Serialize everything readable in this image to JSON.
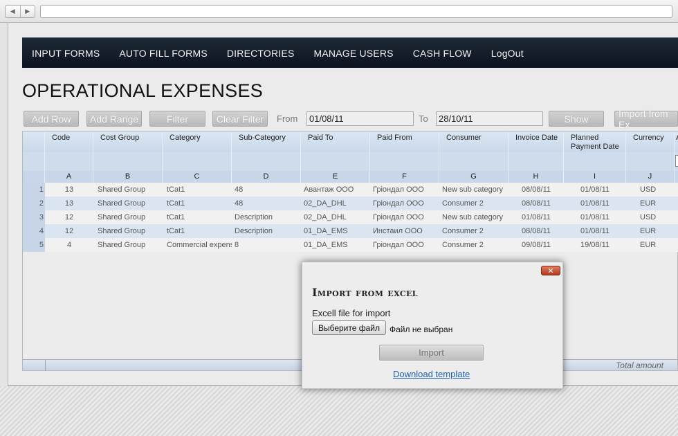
{
  "nav": {
    "items": [
      "INPUT FORMS",
      "AUTO FILL FORMS",
      "DIRECTORIES",
      "MANAGE USERS",
      "CASH FLOW",
      "LogOut"
    ]
  },
  "page": {
    "title": "OPERATIONAL EXPENSES"
  },
  "toolbar": {
    "add_row": "Add Row",
    "add_range": "Add Range",
    "filter": "Filter",
    "clear_filter": "Clear Filter",
    "from_label": "From",
    "from_value": "01/08/11",
    "to_label": "To",
    "to_value": "28/10/11",
    "show": "Show",
    "import": "Import from Ex"
  },
  "grid": {
    "headers": [
      "Code",
      "Cost Group",
      "Category",
      "Sub-Category",
      "Paid To",
      "Paid From",
      "Consumer",
      "Invoice Date",
      "Planned Payment Date",
      "Currency",
      "A"
    ],
    "letters": [
      "A",
      "B",
      "C",
      "D",
      "E",
      "F",
      "G",
      "H",
      "I",
      "J"
    ],
    "rows": [
      {
        "n": "1",
        "code": "13",
        "group": "Shared Group",
        "cat": "tCat1",
        "sub": "48",
        "to": "Авантаж ООО",
        "from": "Гріондал ООО",
        "consumer": "New sub category",
        "inv": "08/08/11",
        "plan": "01/08/11",
        "cur": "USD"
      },
      {
        "n": "2",
        "code": "13",
        "group": "Shared Group",
        "cat": "tCat1",
        "sub": "48",
        "to": "02_DA_DHL",
        "from": "Гріондал ООО",
        "consumer": "Consumer 2",
        "inv": "08/08/11",
        "plan": "01/08/11",
        "cur": "EUR"
      },
      {
        "n": "3",
        "code": "12",
        "group": "Shared Group",
        "cat": "tCat1",
        "sub": "Description",
        "to": "02_DA_DHL",
        "from": "Гріондал ООО",
        "consumer": "New sub category",
        "inv": "01/08/11",
        "plan": "01/08/11",
        "cur": "USD"
      },
      {
        "n": "4",
        "code": "12",
        "group": "Shared Group",
        "cat": "tCat1",
        "sub": "Description",
        "to": "01_DA_EMS",
        "from": "Инстаил ООО",
        "consumer": "Consumer 2",
        "inv": "08/08/11",
        "plan": "01/08/11",
        "cur": "EUR"
      },
      {
        "n": "5",
        "code": "4",
        "group": "Shared Group",
        "cat": "Commercial expense",
        "sub": "8",
        "to": "01_DA_EMS",
        "from": "Гріондал ООО",
        "consumer": "Consumer 2",
        "inv": "09/08/11",
        "plan": "19/08/11",
        "cur": "EUR"
      }
    ],
    "total_label": "Total amount"
  },
  "modal": {
    "close": "✕",
    "title": "Import from excel",
    "label": "Excell file for import",
    "file_button": "Выберите файл",
    "file_status": "Файл не выбран",
    "import_button": "Import",
    "download_link": "Download template"
  }
}
